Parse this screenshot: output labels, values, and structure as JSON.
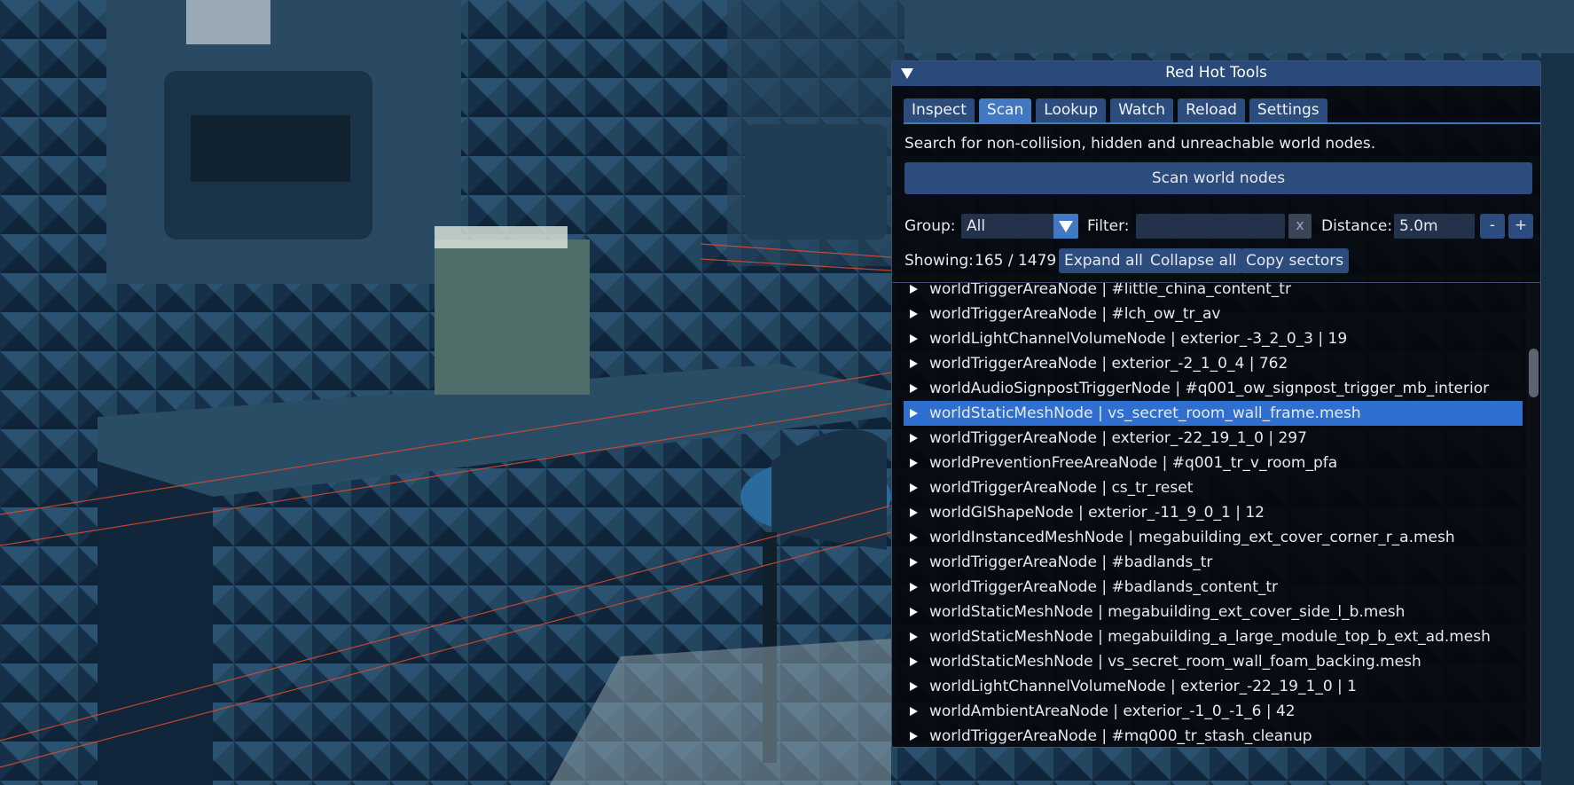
{
  "window": {
    "title": "Red Hot Tools"
  },
  "tabs": [
    {
      "label": "Inspect",
      "active": false
    },
    {
      "label": "Scan",
      "active": true
    },
    {
      "label": "Lookup",
      "active": false
    },
    {
      "label": "Watch",
      "active": false
    },
    {
      "label": "Reload",
      "active": false
    },
    {
      "label": "Settings",
      "active": false
    }
  ],
  "scan": {
    "description": "Search for non-collision, hidden and unreachable world nodes.",
    "scan_button": "Scan world nodes"
  },
  "controls": {
    "group_label": "Group:",
    "group_value": "All",
    "filter_label": "Filter:",
    "filter_value": "",
    "clear_label": "x",
    "distance_label": "Distance:",
    "distance_value": "5.0m",
    "minus_label": "-",
    "plus_label": "+"
  },
  "summary": {
    "showing_label": "Showing:",
    "showing_value": "165 / 1479",
    "expand_all": "Expand all",
    "collapse_all": "Collapse all",
    "copy_sectors": "Copy sectors"
  },
  "nodes": [
    "worldTriggerAreaNode | #little_china_content_tr",
    "worldTriggerAreaNode | #lch_ow_tr_av",
    "worldLightChannelVolumeNode | exterior_-3_2_0_3 | 19",
    "worldTriggerAreaNode | exterior_-2_1_0_4 | 762",
    "worldAudioSignpostTriggerNode | #q001_ow_signpost_trigger_mb_interior",
    "worldStaticMeshNode | vs_secret_room_wall_frame.mesh",
    "worldTriggerAreaNode | exterior_-22_19_1_0 | 297",
    "worldPreventionFreeAreaNode | #q001_tr_v_room_pfa",
    "worldTriggerAreaNode | cs_tr_reset",
    "worldGIShapeNode | exterior_-11_9_0_1 | 12",
    "worldInstancedMeshNode | megabuilding_ext_cover_corner_r_a.mesh",
    "worldTriggerAreaNode | #badlands_tr",
    "worldTriggerAreaNode | #badlands_content_tr",
    "worldStaticMeshNode | megabuilding_ext_cover_side_l_b.mesh",
    "worldStaticMeshNode | megabuilding_a_large_module_top_b_ext_ad.mesh",
    "worldStaticMeshNode | vs_secret_room_wall_foam_backing.mesh",
    "worldLightChannelVolumeNode | exterior_-22_19_1_0 | 1",
    "worldAmbientAreaNode | exterior_-1_0_-1_6 | 42",
    "worldTriggerAreaNode | #mq000_tr_stash_cleanup"
  ],
  "selected_index": 5,
  "scroll_position": 0.16
}
